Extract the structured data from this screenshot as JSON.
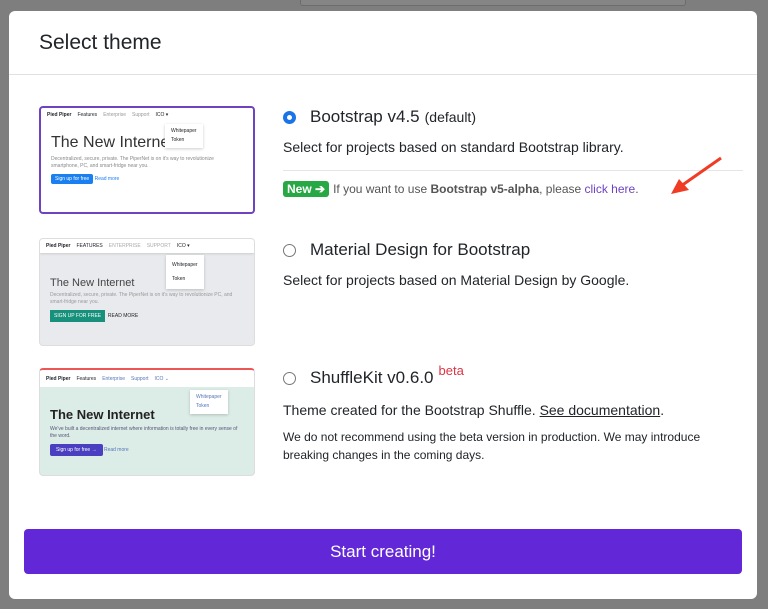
{
  "modal": {
    "title": "Select theme",
    "start_label": "Start creating!"
  },
  "themes": [
    {
      "name": "Bootstrap v4.5",
      "suffix": "(default)",
      "description": "Select for projects based on standard Bootstrap library.",
      "selected": true,
      "notice": {
        "badge": "New ➔",
        "text_before": "If you want to use ",
        "bold": "Bootstrap v5-alpha",
        "text_mid": ", please ",
        "link": "click here",
        "text_after": "."
      },
      "preview": {
        "brand": "Pied Piper",
        "nav": [
          "Features",
          "Enterprise",
          "Support",
          "ICO ▾"
        ],
        "dropdown": [
          "Whitepaper",
          "Token"
        ],
        "heading": "The New Internet",
        "lead": "Decentralized, secure, private. The PiperNet is on it's way to revolutionize smartphone, PC, and smart-fridge near you.",
        "primary": "Sign up for free",
        "secondary": "Read more"
      }
    },
    {
      "name": "Material Design for Bootstrap",
      "description": "Select for projects based on Material Design by Google.",
      "selected": false,
      "preview": {
        "brand": "Pied Piper",
        "nav": [
          "FEATURES",
          "ENTERPRISE",
          "SUPPORT",
          "ICO ▾"
        ],
        "dropdown": [
          "Whitepaper",
          "Token"
        ],
        "heading": "The New Internet",
        "lead": "Decentralized, secure, private. The PiperNet is on it's way to revolutionize PC, and smart-fridge near you.",
        "primary": "SIGN UP FOR FREE",
        "secondary": "READ MORE"
      }
    },
    {
      "name": "ShuffleKit v0.6.0",
      "badge": "beta",
      "description_before": "Theme created for the Bootstrap Shuffle. ",
      "link": "See documentation",
      "description_after": ".",
      "warning": "We do not recommend using the beta version in production. We may introduce breaking changes in the coming days.",
      "selected": false,
      "preview": {
        "brand": "Pied Piper",
        "nav": [
          "Features",
          "Enterprise",
          "Support",
          "ICO ⌄"
        ],
        "dropdown": [
          "Whitepaper",
          "Token"
        ],
        "heading": "The New Internet",
        "lead": "We've built a decentralized internet where information is totally free in every sense of the word.",
        "primary": "Sign up for free →",
        "secondary": "Read more"
      }
    }
  ],
  "colors": {
    "accent": "#6228d7",
    "selected_border": "#6f42c1",
    "new_badge": "#28a745",
    "beta": "#dc3545",
    "arrow": "#f03c24"
  }
}
